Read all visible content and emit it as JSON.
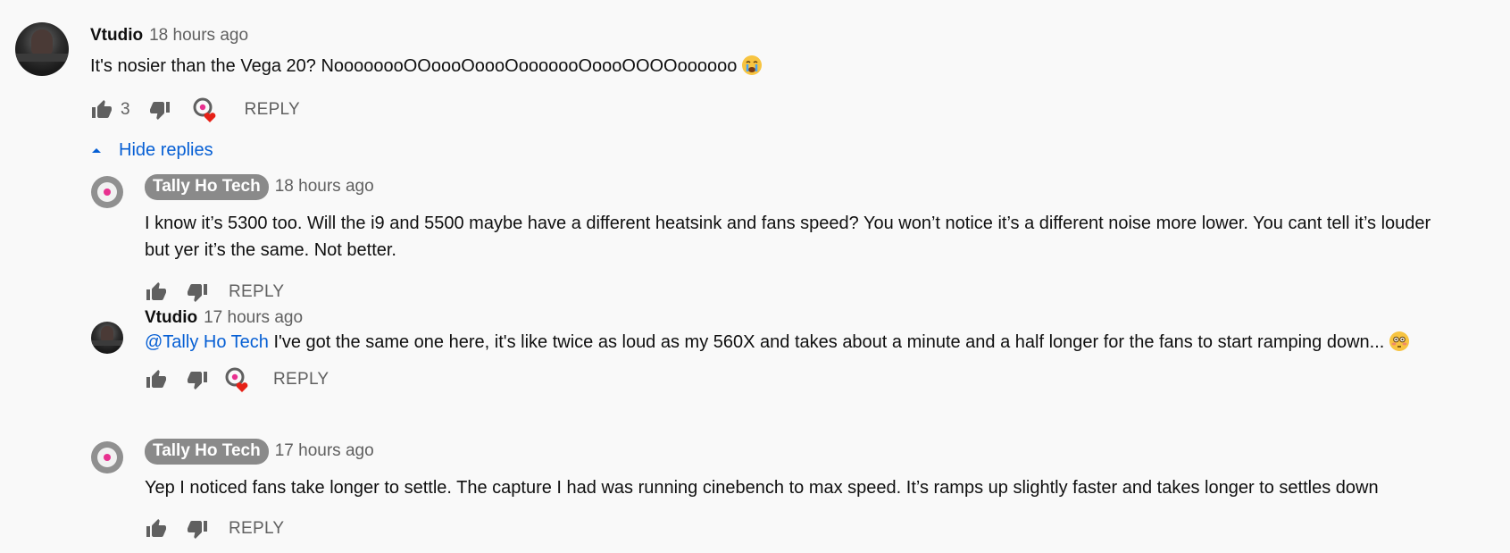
{
  "comments": [
    {
      "author": "Vtudio",
      "time": "18 hours ago",
      "text": "It's nosier than the Vega 20? NoooooooOOoooOoooOooooooOoooOOOOoooooo",
      "emoji": "crying-face",
      "likes": "3",
      "reply_label": "REPLY",
      "hearted": true
    }
  ],
  "toggle": {
    "label": "Hide replies"
  },
  "replies": [
    {
      "author": "Tally Ho Tech",
      "time": "18 hours ago",
      "text": "I know it’s 5300 too. Will the i9 and 5500 maybe have a different heatsink and fans speed? You won’t notice it’s a different noise more lower. You cant tell it’s louder but yer it’s the same. Not better.",
      "reply_label": "REPLY",
      "hearted": false
    },
    {
      "author": "Vtudio",
      "time": "17 hours ago",
      "mention": "@Tally Ho Tech",
      "text": " I've got the same one here, it's like twice as loud as my 560X and takes about a minute and a half longer for the fans to start ramping down...",
      "emoji": "flushed-face",
      "reply_label": "REPLY",
      "hearted": true
    },
    {
      "author": "Tally Ho Tech",
      "time": "17 hours ago",
      "text": "Yep I noticed fans take longer to settle. The capture I had was running cinebench to max speed. It’s ramps up slightly faster and takes longer to settles down",
      "reply_label": "REPLY",
      "hearted": false
    }
  ],
  "colors": {
    "background": "#f9f9f9",
    "link": "#065fd4",
    "heart": "#e62117",
    "chip": "#8a8a8a",
    "ring_dot": "#e8308f"
  }
}
